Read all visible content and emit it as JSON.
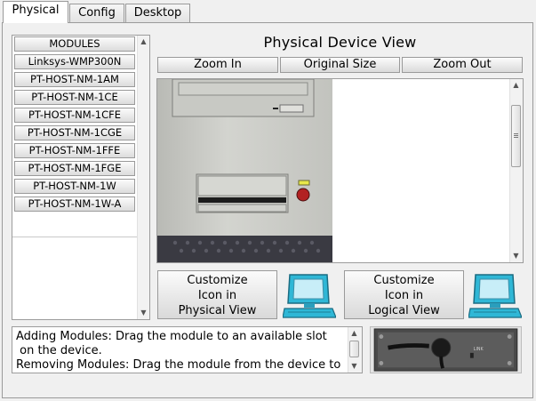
{
  "tabs": [
    {
      "label": "Physical",
      "active": true
    },
    {
      "label": "Config",
      "active": false
    },
    {
      "label": "Desktop",
      "active": false
    }
  ],
  "modules": {
    "header": "MODULES",
    "items": [
      "Linksys-WMP300N",
      "PT-HOST-NM-1AM",
      "PT-HOST-NM-1CE",
      "PT-HOST-NM-1CFE",
      "PT-HOST-NM-1CGE",
      "PT-HOST-NM-1FFE",
      "PT-HOST-NM-1FGE",
      "PT-HOST-NM-1W",
      "PT-HOST-NM-1W-A"
    ]
  },
  "physical_view": {
    "title": "Physical Device View",
    "zoom_in": "Zoom In",
    "original_size": "Original Size",
    "zoom_out": "Zoom Out"
  },
  "customize": {
    "physical": {
      "line1": "Customize",
      "line2": "Icon in",
      "line3": "Physical View"
    },
    "logical": {
      "line1": "Customize",
      "line2": "Icon in",
      "line3": "Logical View"
    }
  },
  "help": {
    "line1": "Adding Modules: Drag the module to an available slot",
    "line2": " on the device.",
    "line3": "Removing Modules: Drag the module from the device to"
  },
  "module_preview": {
    "port_label": "LINK"
  },
  "colors": {
    "window_bg": "#f0f0f0",
    "case_gray": "#c9cac6",
    "case_dark": "#3a3a42",
    "monitor_cyan": "#2fb7d6",
    "power_led": "#e8e84a",
    "power_button": "#b22222"
  }
}
